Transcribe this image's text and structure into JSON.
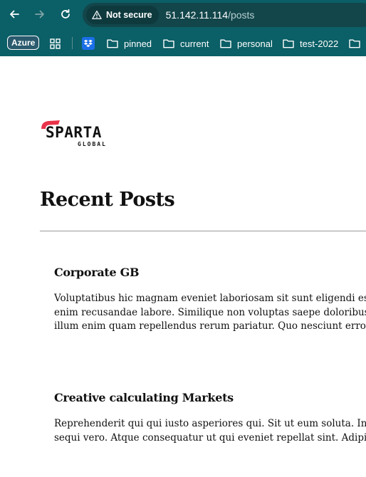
{
  "browser": {
    "security_label": "Not secure",
    "url_host": "51.142.11.114",
    "url_path": "/posts",
    "bookmarks": {
      "azure": "Azure",
      "folders": [
        "pinned",
        "current",
        "personal",
        "test-2022"
      ]
    },
    "icons": [
      "back-arrow-icon",
      "forward-arrow-icon",
      "reload-icon",
      "warning-icon",
      "apps-grid-icon",
      "dropbox-icon",
      "folder-icon"
    ],
    "colors": {
      "toolbar": "#0b5f66",
      "omnibox": "#12464b"
    }
  },
  "logo": {
    "main": "SPARTA",
    "sub": "GLOBAL",
    "accent": "#e8334a"
  },
  "page": {
    "title": "Recent Posts"
  },
  "posts": [
    {
      "title": "Corporate GB",
      "lines": [
        "Voluptatibus hic magnam eveniet laboriosam sit sunt eligendi est. Dic",
        "enim recusandae labore. Similique non voluptas saepe doloribus minu",
        "illum enim quam repellendus rerum pariatur. Quo nesciunt error facili"
      ]
    },
    {
      "title": "Creative calculating Markets",
      "lines": [
        "Reprehenderit qui qui iusto asperiores qui. Sit ut eum soluta. Inventore",
        "sequi vero. Atque consequatur ut qui eveniet repellat sint. Adipisci odi"
      ]
    }
  ]
}
